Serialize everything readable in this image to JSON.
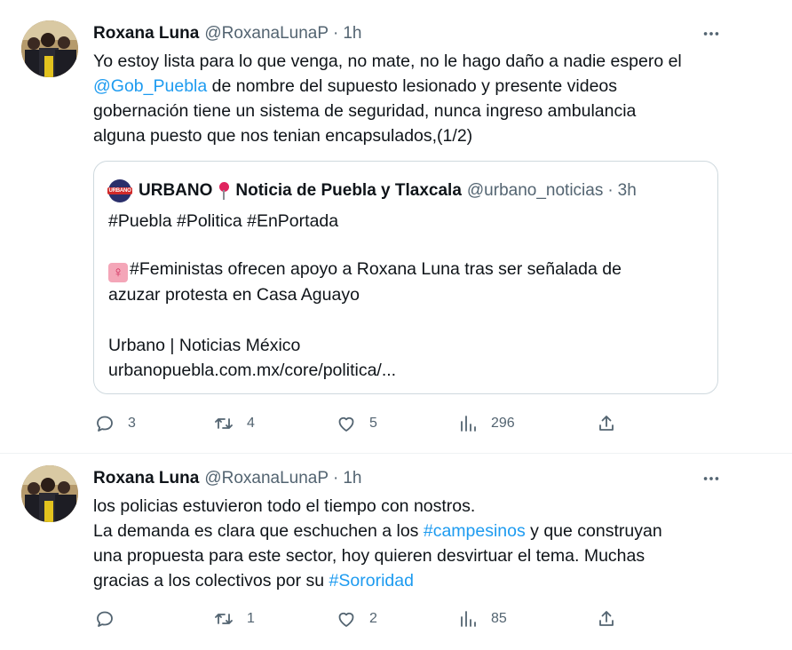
{
  "tweets": [
    {
      "author_name": "Roxana Luna",
      "handle": "@RoxanaLunaP",
      "separator": "·",
      "time": "1h",
      "text_part1": "Yo estoy lista para lo que venga, no mate, no le hago daño a nadie espero el",
      "mention": "@Gob_Puebla",
      "text_part2": " de nombre del supuesto lesionado y presente videos",
      "text_line3": "gobernación tiene un sistema de seguridad, nunca ingreso ambulancia",
      "text_line4": "alguna puesto que nos tenian encapsulados,(1/2)",
      "quote": {
        "author_name": "URBANO",
        "author_name_suffix": "Noticia de Puebla y Tlaxcala",
        "avatar_text": "URBANO",
        "handle": "@urbano_noticias",
        "separator": "·",
        "time": "3h",
        "hashtags": "#Puebla #Politica #EnPortada",
        "headline_line1": "#Feministas  ofrecen apoyo a Roxana Luna tras ser señalada de",
        "headline_line2": "azuzar protesta en Casa Aguayo",
        "source": "Urbano | Noticias México",
        "url": "urbanopuebla.com.mx/core/politica/..."
      },
      "counts": {
        "replies": "3",
        "retweets": "4",
        "likes": "5",
        "views": "296"
      }
    },
    {
      "author_name": "Roxana Luna",
      "handle": "@RoxanaLunaP",
      "separator": "·",
      "time": "1h",
      "line1": "los policias estuvieron todo el tiempo con nostros.",
      "line2_part1": "La demanda es clara que eschuchen a los ",
      "hashtag1": "#campesinos",
      "line2_part2": " y que construyan",
      "line3": "una propuesta para este sector, hoy quieren desvirtuar el tema. Muchas",
      "line4_part1": "gracias a los colectivos por su ",
      "hashtag2": "#Sororidad",
      "counts": {
        "replies": "",
        "retweets": "1",
        "likes": "2",
        "views": "85"
      }
    }
  ],
  "icons": [
    "reply-icon",
    "retweet-icon",
    "like-icon",
    "views-icon",
    "share-icon",
    "more-icon",
    "pin-icon",
    "female-sign-icon"
  ],
  "colors": {
    "link": "#1d9bf0",
    "muted": "#536471",
    "border": "#cfd9de",
    "text": "#0f1419"
  }
}
